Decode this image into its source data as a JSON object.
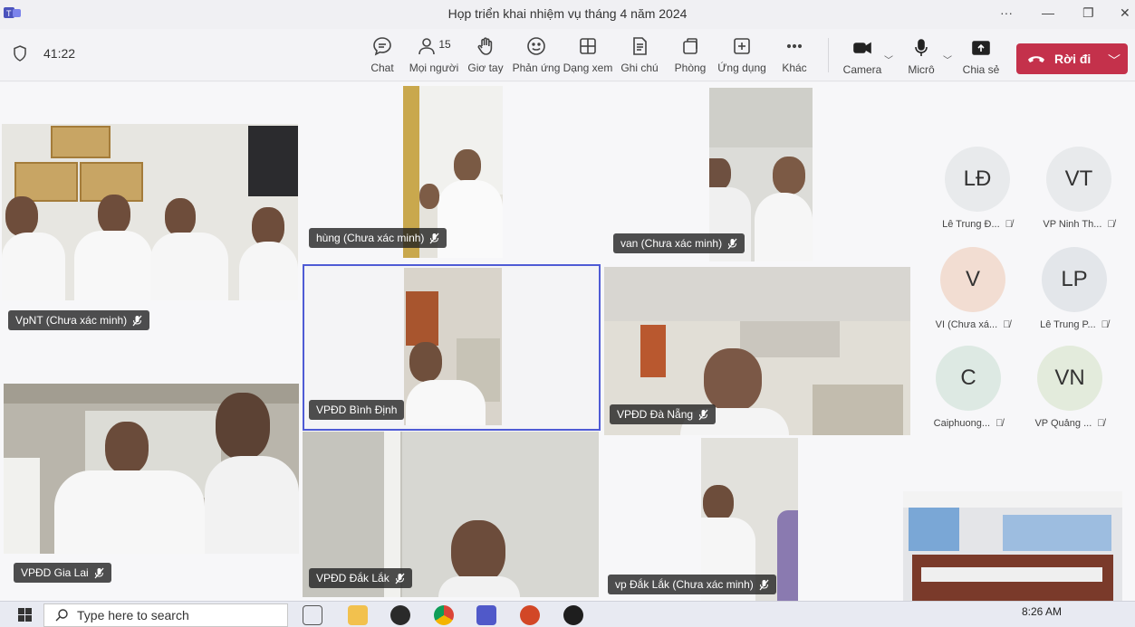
{
  "window": {
    "title": "Họp triển khai nhiệm vụ tháng 4 năm 2024",
    "more": "···"
  },
  "toolbar": {
    "timer": "41:22",
    "buttons": [
      {
        "label": "Chat",
        "icon": "chat-icon"
      },
      {
        "label": "Mọi người",
        "icon": "people-icon",
        "badge": "15"
      },
      {
        "label": "Giơ tay",
        "icon": "raise-hand-icon"
      },
      {
        "label": "Phản ứng",
        "icon": "smile-icon"
      },
      {
        "label": "Dạng xem",
        "icon": "grid-view-icon"
      },
      {
        "label": "Ghi chú",
        "icon": "notes-icon"
      },
      {
        "label": "Phòng",
        "icon": "rooms-icon"
      },
      {
        "label": "Ứng dụng",
        "icon": "apps-icon"
      },
      {
        "label": "Khác",
        "icon": "more-icon"
      }
    ],
    "camera_label": "Camera",
    "mic_label": "Micrô",
    "share_label": "Chia sẻ",
    "leave_label": "Rời đi",
    "leave_color": "#c4314b"
  },
  "tiles": [
    {
      "label": "hùng (Chưa xác minh)"
    },
    {
      "label": "van (Chưa xác minh)"
    },
    {
      "label": "VpNT (Chưa xác minh)"
    },
    {
      "label": "VPĐD Bình Định"
    },
    {
      "label": "VPĐD Đà Nẵng"
    },
    {
      "label": "VPĐD Gia Lai"
    },
    {
      "label": "VPĐD Đắk Lắk"
    },
    {
      "label": "vp Đắk Lắk (Chưa xác minh)"
    }
  ],
  "avatars": [
    {
      "initials": "LĐ",
      "name": "Lê Trung Đ...",
      "color": "#e8eaec"
    },
    {
      "initials": "VT",
      "name": "VP Ninh Th...",
      "color": "#e8eaec"
    },
    {
      "initials": "V",
      "name": "VI (Chưa xá...",
      "color": "#f2ddd2"
    },
    {
      "initials": "LP",
      "name": "Lê Trung P...",
      "color": "#e3e6ea"
    },
    {
      "initials": "C",
      "name": "Caiphuong...",
      "color": "#dde9e3"
    },
    {
      "initials": "VN",
      "name": "VP Quảng ...",
      "color": "#e3ebdc"
    }
  ],
  "taskbar": {
    "search_placeholder": "Type here to search",
    "time": "8:26 AM"
  }
}
